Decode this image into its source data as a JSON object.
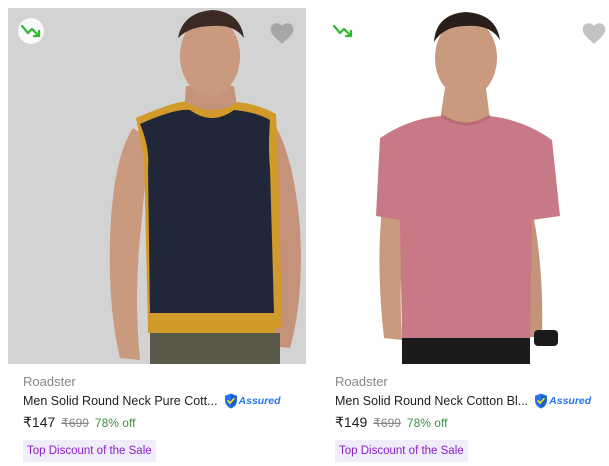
{
  "products": [
    {
      "brand": "Roadster",
      "title": "Men Solid Round Neck Pure Cott...",
      "assured_label": "Assured",
      "price": "₹147",
      "mrp": "₹699",
      "discount": "78% off",
      "offer_tag": "Top Discount of the Sale",
      "image_icon": "navy-sleeveless-tshirt-photo",
      "trend_icon": "trending-down-icon",
      "wishlist_icon": "heart-icon",
      "colors": {
        "shirt": "#1f2738",
        "trim": "#d19a2a",
        "background": "#d8d8d8"
      }
    },
    {
      "brand": "Roadster",
      "title": "Men Solid Round Neck Cotton Bl...",
      "assured_label": "Assured",
      "price": "₹149",
      "mrp": "₹699",
      "discount": "78% off",
      "offer_tag": "Top Discount of the Sale",
      "image_icon": "pink-tshirt-photo",
      "trend_icon": "trending-down-icon",
      "wishlist_icon": "heart-icon",
      "colors": {
        "shirt": "#c77a85",
        "trim": "#b96b77",
        "background": "#ffffff"
      }
    }
  ],
  "colors": {
    "price_green": "#388e3c",
    "assured_blue": "#2874f0",
    "offer_purple": "#8a1fc6",
    "offer_bg": "#f1ecfa"
  }
}
